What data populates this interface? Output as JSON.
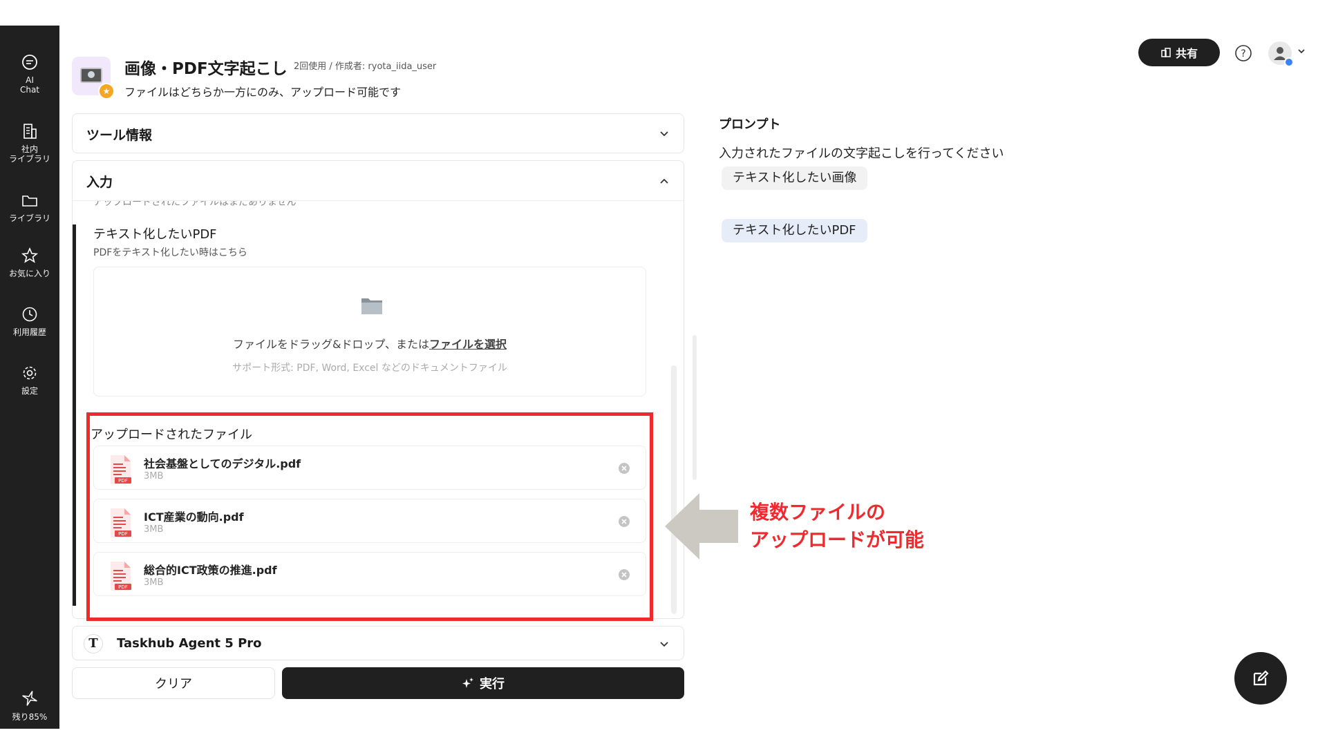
{
  "sidebar": {
    "items": [
      {
        "label": "AI\nChat"
      },
      {
        "label": "社内\nライブラリ"
      },
      {
        "label": "ライブラリ"
      },
      {
        "label": "お気に入り"
      },
      {
        "label": "利用履歴"
      },
      {
        "label": "設定"
      }
    ],
    "remaining": "残り85%"
  },
  "header": {
    "title": "画像・PDF文字起こし",
    "meta": "2回使用 / 作成者: ryota_iida_user",
    "description": "ファイルはどちらか一方にのみ、アップロード可能です",
    "share_label": "共有"
  },
  "panels": {
    "tool_info": "ツール情報",
    "input": "入力"
  },
  "input": {
    "cut_text": "アップロードされたファイルはまだありません",
    "field_label": "テキスト化したいPDF",
    "field_sub": "PDFをテキスト化したい時はこちら",
    "dropzone_text": "ファイルをドラッグ&ドロップ、または",
    "dropzone_link": "ファイルを選択",
    "dropzone_support": "サポート形式: PDF, Word, Excel などのドキュメントファイル",
    "uploaded_title": "アップロードされたファイル",
    "files": [
      {
        "name": "社会基盤としてのデジタル.pdf",
        "size": "3MB"
      },
      {
        "name": "ICT産業の動向.pdf",
        "size": "3MB"
      },
      {
        "name": "総合的ICT政策の推進.pdf",
        "size": "3MB"
      }
    ],
    "pdf_badge": "PDF"
  },
  "model": {
    "name": "Taskhub Agent 5 Pro",
    "logo": "T"
  },
  "actions": {
    "clear": "クリア",
    "run": "実行"
  },
  "prompt": {
    "label": "プロンプト",
    "text": "入力されたファイルの文字起こしを行ってください",
    "chips": [
      "テキスト化したい画像",
      "テキスト化したいPDF"
    ]
  },
  "annotation": {
    "line1": "複数ファイルの",
    "line2": "アップロードが可能"
  },
  "colors": {
    "sidebar": "#202020",
    "highlight": "#ee2a2f",
    "accent_chip": "#e7ecf9"
  }
}
